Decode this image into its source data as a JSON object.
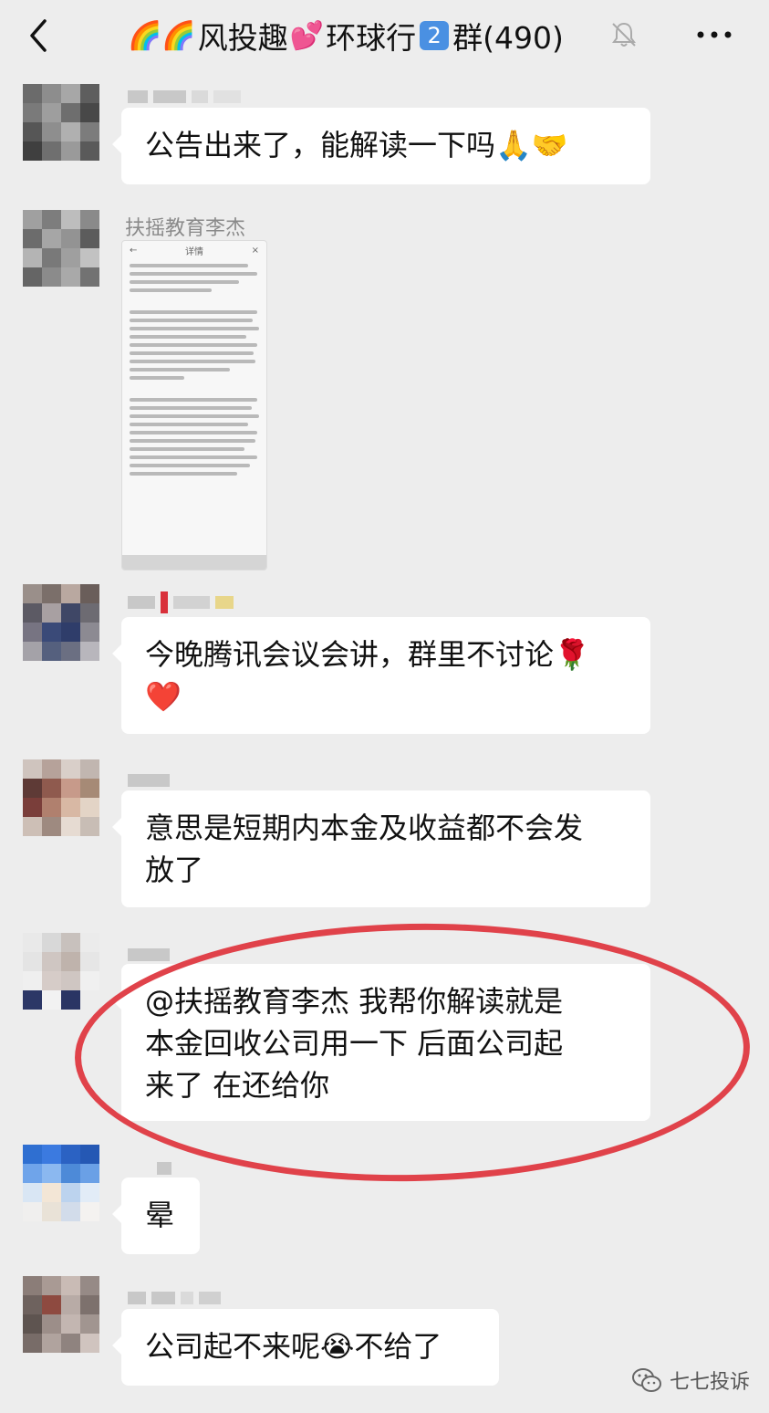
{
  "header": {
    "title_prefix_emoji": "🌈🌈",
    "title_part1": "风投趣",
    "title_heart": "💕",
    "title_part2": "环球行",
    "title_badge": "2",
    "title_part3": "群(490)"
  },
  "messages": [
    {
      "text": "公告出来了，能解读一下吗",
      "emoji": "🙏🤝"
    },
    {
      "sender": "扶摇教育李杰",
      "attachment": "document-screenshot"
    },
    {
      "text": "今晚腾讯会议会讲，群里不讨论",
      "emoji": "🌹",
      "emoji2": "❤️"
    },
    {
      "line1": "意思是短期内本金及收益都不会发",
      "line2": "放了"
    },
    {
      "line1": "@扶摇教育李杰   我帮你解读就是",
      "line2": "本金回收公司用一下 后面公司起",
      "line3": "来了 在还给你"
    },
    {
      "text": "晕"
    },
    {
      "text_a": "公司起不来呢",
      "emoji": "😭",
      "text_b": "不给了"
    }
  ],
  "doc_preview": {
    "header_label": "详情"
  },
  "watermark": {
    "text": "七七投诉"
  },
  "colors": {
    "background": "#ededed",
    "bubble": "#ffffff",
    "highlight": "#e0424a",
    "badge": "#4a90e2"
  }
}
